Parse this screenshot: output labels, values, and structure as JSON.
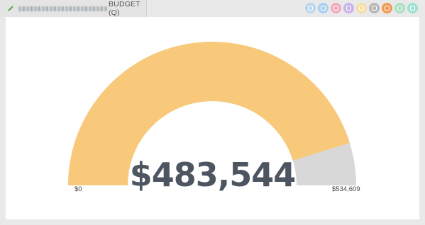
{
  "widget": {
    "title": "BUDGET (Q)"
  },
  "toolbar": {
    "buttons": [
      {
        "name": "table-view-icon",
        "color": "#b9d7ee"
      },
      {
        "name": "bar-chart-icon",
        "color": "#a8d1f0"
      },
      {
        "name": "line-chart-icon",
        "color": "#f2aabd"
      },
      {
        "name": "area-chart-icon",
        "color": "#c9b4ea"
      },
      {
        "name": "pie-chart-icon",
        "color": "#f6dfa2"
      },
      {
        "name": "grid-view-icon",
        "color": "#b7b7b7"
      },
      {
        "name": "gauge-chart-icon",
        "color": "#f19a54"
      },
      {
        "name": "number-view-icon",
        "color": "#a8e0c0"
      },
      {
        "name": "funnel-chart-icon",
        "color": "#9fe1d1"
      }
    ]
  },
  "gauge": {
    "value_label": "$483,544",
    "min_label": "$0",
    "max_label": "$534,609",
    "fill_color": "#f8c97b",
    "track_color": "#d8d8d8"
  },
  "chart_data": {
    "type": "gauge",
    "value": 483544,
    "min": 0,
    "max": 534609
  }
}
